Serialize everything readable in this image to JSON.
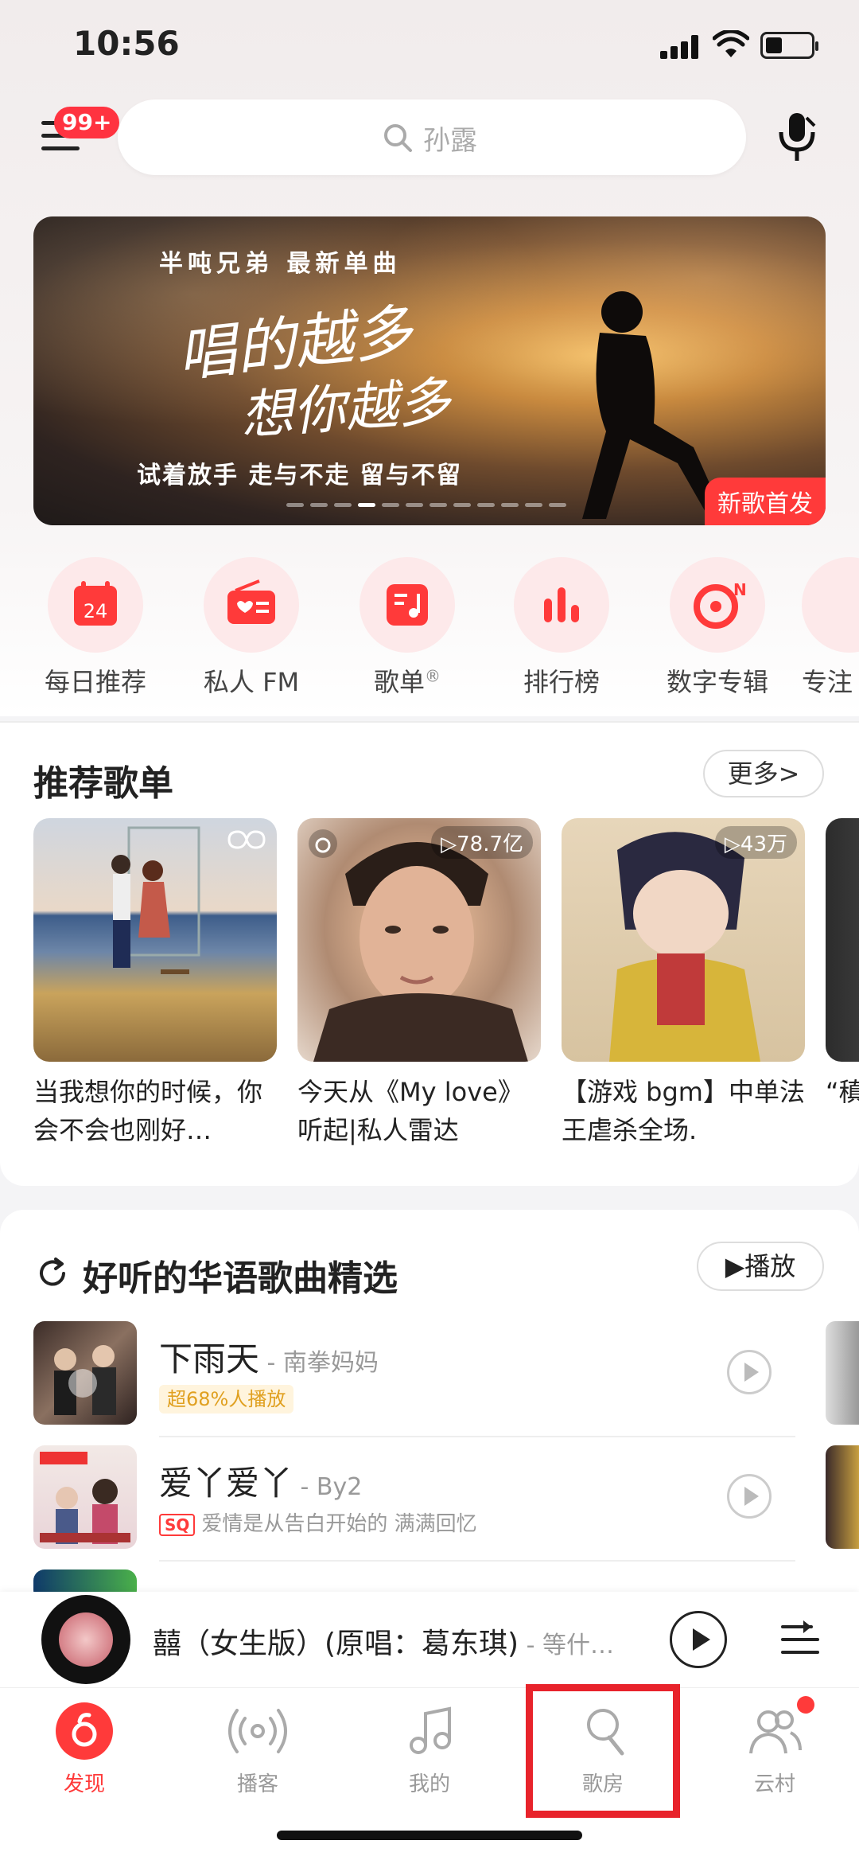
{
  "status_bar": {
    "time": "10:56"
  },
  "header": {
    "menu_badge": "99+",
    "search_placeholder": "孙露"
  },
  "banner": {
    "subtitle": "半吨兄弟  最新单曲",
    "script_line1": "唱的越多",
    "script_line2": "想你越多",
    "tagline": "试着放手 走与不走 留与不留",
    "tag": "新歌首发"
  },
  "quick_entries": [
    {
      "label": "每日推荐",
      "icon": "calendar-icon",
      "date": "24"
    },
    {
      "label": "私人 FM",
      "icon": "radio-icon"
    },
    {
      "label": "歌单",
      "icon": "playlist-icon",
      "mark": "®"
    },
    {
      "label": "排行榜",
      "icon": "chart-icon"
    },
    {
      "label": "数字专辑",
      "icon": "album-icon"
    },
    {
      "label": "专注",
      "icon": "focus-icon"
    }
  ],
  "recommended": {
    "title": "推荐歌单",
    "more": "更多>",
    "playlists": [
      {
        "caption": "当我想你的时候，你会不会也刚好…",
        "count": ""
      },
      {
        "caption": "今天从《My love》听起|私人雷达",
        "count": "▷78.7亿"
      },
      {
        "caption": "【游戏 bgm】中单法王虐杀全场.",
        "count": "▷43万"
      },
      {
        "caption": "“稹",
        "count": ""
      }
    ]
  },
  "songs_section": {
    "title": "好听的华语歌曲精选",
    "play_all": "▶播放",
    "songs": [
      {
        "title": "下雨天",
        "artist": " - 南拳妈妈",
        "sub": "超68%人播放"
      },
      {
        "title": "爱丫爱丫",
        "artist": " - By2",
        "sq": "SQ",
        "sub": "爱情是从告白开始的 满满回忆"
      }
    ]
  },
  "now_playing": {
    "title": "囍（女生版）(原唱：葛东琪)",
    "artist": " - 等什…"
  },
  "tabs": [
    {
      "label": "发现",
      "icon": "discover-icon",
      "active": true
    },
    {
      "label": "播客",
      "icon": "podcast-icon"
    },
    {
      "label": "我的",
      "icon": "music-note-icon"
    },
    {
      "label": "歌房",
      "icon": "karaoke-mic-icon"
    },
    {
      "label": "云村",
      "icon": "community-icon"
    }
  ],
  "colors": {
    "accent": "#ff3a3a",
    "highlight": "#e8232b"
  }
}
